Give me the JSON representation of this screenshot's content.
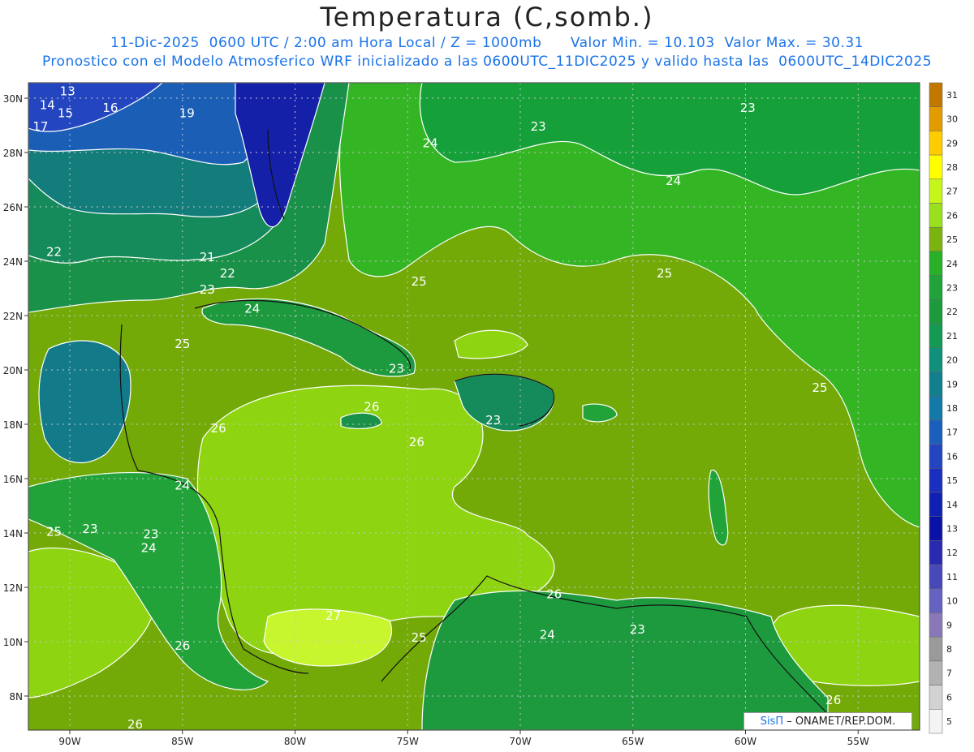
{
  "header": {
    "title": "Temperatura (C,somb.)",
    "subtitle1": "11-Dic-2025  0600 UTC / 2:00 am Hora Local / Z = 1000mb      Valor Min. = 10.103  Valor Max. = 30.31",
    "subtitle2": "Pronostico con el Modelo Atmosferico WRF inicializado a las 0600UTC_11DIC2025 y valido hasta las  0600UTC_14DIC2025"
  },
  "map": {
    "lat_labels": [
      "30N",
      "28N",
      "26N",
      "24N",
      "22N",
      "20N",
      "18N",
      "16N",
      "14N",
      "12N",
      "10N",
      "8N"
    ],
    "lon_labels": [
      "90W",
      "85W",
      "80W",
      "75W",
      "70W",
      "65W",
      "60W",
      "55W"
    ],
    "contour_labels": [
      {
        "text": "13",
        "lon": -90.1,
        "lat": 30.1
      },
      {
        "text": "14",
        "lon": -91.0,
        "lat": 29.6
      },
      {
        "text": "15",
        "lon": -90.2,
        "lat": 29.3
      },
      {
        "text": "16",
        "lon": -88.2,
        "lat": 29.5
      },
      {
        "text": "17",
        "lon": -91.3,
        "lat": 28.8
      },
      {
        "text": "19",
        "lon": -84.8,
        "lat": 29.3
      },
      {
        "text": "22",
        "lon": -90.7,
        "lat": 24.2
      },
      {
        "text": "21",
        "lon": -83.9,
        "lat": 24.0
      },
      {
        "text": "22",
        "lon": -83.0,
        "lat": 23.4
      },
      {
        "text": "23",
        "lon": -83.9,
        "lat": 22.8
      },
      {
        "text": "24",
        "lon": -81.9,
        "lat": 22.1
      },
      {
        "text": "25",
        "lon": -85.0,
        "lat": 20.8
      },
      {
        "text": "23",
        "lon": -75.5,
        "lat": 19.9
      },
      {
        "text": "26",
        "lon": -76.6,
        "lat": 18.5
      },
      {
        "text": "23",
        "lon": -71.2,
        "lat": 18.0
      },
      {
        "text": "26",
        "lon": -83.4,
        "lat": 17.7
      },
      {
        "text": "26",
        "lon": -74.6,
        "lat": 17.2
      },
      {
        "text": "24",
        "lon": -85.0,
        "lat": 15.6
      },
      {
        "text": "25",
        "lon": -90.7,
        "lat": 13.9
      },
      {
        "text": "23",
        "lon": -89.1,
        "lat": 14.0
      },
      {
        "text": "23",
        "lon": -86.4,
        "lat": 13.8
      },
      {
        "text": "24",
        "lon": -86.5,
        "lat": 13.3
      },
      {
        "text": "24",
        "lon": -74.0,
        "lat": 28.2
      },
      {
        "text": "23",
        "lon": -69.2,
        "lat": 28.8
      },
      {
        "text": "23",
        "lon": -59.9,
        "lat": 29.5
      },
      {
        "text": "24",
        "lon": -63.2,
        "lat": 26.8
      },
      {
        "text": "25",
        "lon": -74.5,
        "lat": 23.1
      },
      {
        "text": "25",
        "lon": -63.6,
        "lat": 23.4
      },
      {
        "text": "25",
        "lon": -56.7,
        "lat": 19.2
      },
      {
        "text": "27",
        "lon": -78.3,
        "lat": 10.8
      },
      {
        "text": "25",
        "lon": -74.5,
        "lat": 10.0
      },
      {
        "text": "26",
        "lon": -85.0,
        "lat": 9.7
      },
      {
        "text": "26",
        "lon": -68.5,
        "lat": 11.6
      },
      {
        "text": "24",
        "lon": -68.8,
        "lat": 10.1
      },
      {
        "text": "23",
        "lon": -64.8,
        "lat": 10.3
      },
      {
        "text": "26",
        "lon": -87.1,
        "lat": 6.8
      },
      {
        "text": "26",
        "lon": -56.1,
        "lat": 7.7
      }
    ]
  },
  "colorbar": {
    "labels": [
      "31",
      "30",
      "29",
      "28",
      "27",
      "26",
      "25",
      "24",
      "23",
      "22",
      "21",
      "20",
      "19",
      "18",
      "17",
      "16",
      "15",
      "14",
      "13",
      "12",
      "11",
      "10",
      "9",
      "8",
      "7",
      "6",
      "5"
    ],
    "colors": [
      "#c07800",
      "#e39c00",
      "#ffcc00",
      "#ffff00",
      "#c5f51a",
      "#9ae01e",
      "#7bb311",
      "#28b028",
      "#22a33a",
      "#1e9a3e",
      "#149a54",
      "#10907a",
      "#127f8c",
      "#1479a6",
      "#1a5fbc",
      "#2346c0",
      "#1a2fbf",
      "#1020b2",
      "#0b12a8",
      "#2a2ab0",
      "#4848b8",
      "#6464c0",
      "#8878b8",
      "#9a9a9a",
      "#b2b2b2",
      "#d2d2d2",
      "#f4f4f4"
    ]
  },
  "colors": {
    "c23": "#16a03a",
    "c24": "#33b524",
    "c25": "#73aa08",
    "c26": "#8ed410",
    "c27": "#c7f52e",
    "c22": "#1a9148",
    "c21": "#158a5a",
    "c20": "#127d7a",
    "c19": "#137a8a",
    "c17": "#1a5fb5",
    "c13": "#1420a8",
    "land": "#2f9e3a"
  },
  "credit": {
    "brand": "SisΠ",
    "text": "– ONAMET/REP.DOM."
  }
}
